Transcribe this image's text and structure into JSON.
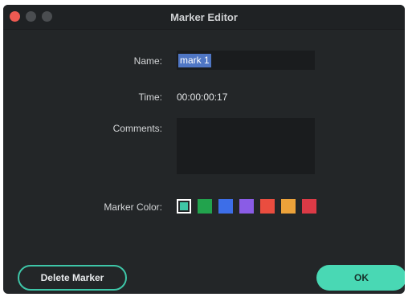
{
  "window": {
    "title": "Marker Editor"
  },
  "form": {
    "name_label": "Name:",
    "name_value": "mark 1",
    "time_label": "Time:",
    "time_value": "00:00:00:17",
    "comments_label": "Comments:",
    "comments_value": "",
    "color_label": "Marker Color:"
  },
  "colors": [
    {
      "name": "teal",
      "hex": "#3fc6a6",
      "selected": true
    },
    {
      "name": "green",
      "hex": "#22a34d",
      "selected": false
    },
    {
      "name": "blue",
      "hex": "#3d6ee8",
      "selected": false
    },
    {
      "name": "purple",
      "hex": "#8a5ce6",
      "selected": false
    },
    {
      "name": "red",
      "hex": "#ea4d3f",
      "selected": false
    },
    {
      "name": "orange",
      "hex": "#eca23a",
      "selected": false
    },
    {
      "name": "crimson",
      "hex": "#dc3a46",
      "selected": false
    }
  ],
  "buttons": {
    "delete_label": "Delete Marker",
    "ok_label": "OK"
  }
}
